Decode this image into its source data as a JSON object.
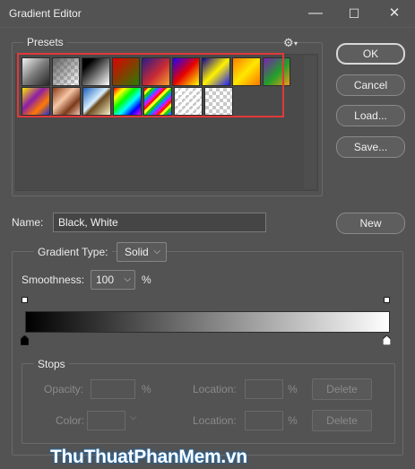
{
  "window": {
    "title": "Gradient Editor",
    "minimize_glyph": "—",
    "maximize_glyph": "☐",
    "close_glyph": "✕"
  },
  "presets": {
    "label": "Presets",
    "gear_glyph": "⚙",
    "gear_menu_glyph": "▾",
    "row1": [
      {
        "name": "foreground-to-background-swatch",
        "css": "linear-gradient(135deg,#f2f2f2,#7b7b7b 50%,#262626)",
        "checker": false
      },
      {
        "name": "foreground-to-transparent-swatch",
        "css": "linear-gradient(135deg,rgba(90,90,90,0.95),rgba(255,255,255,0))",
        "checker": true
      },
      {
        "name": "black-white-swatch",
        "css": "linear-gradient(135deg,#000 0%,#000 20%,#fff 100%)",
        "checker": false
      },
      {
        "name": "red-green-swatch",
        "css": "linear-gradient(135deg,#e00000,#2a7d00)",
        "checker": false
      },
      {
        "name": "violet-orange-swatch",
        "css": "linear-gradient(135deg,#2a1b8a,#c92a35 55%,#f7a12d)",
        "checker": false
      },
      {
        "name": "blue-red-yellow-swatch",
        "css": "linear-gradient(135deg,#1f00ff,#e60000 50%,#ffff00)",
        "checker": false
      },
      {
        "name": "blue-yellow-blue-swatch",
        "css": "linear-gradient(135deg,#10009c,#fff200 50%,#1a1aff)",
        "checker": false
      },
      {
        "name": "orange-yellow-orange-swatch",
        "css": "linear-gradient(135deg,#ff7a00,#ffe800 50%,#ff7400)",
        "checker": false
      },
      {
        "name": "violet-green-orange-swatch",
        "css": "linear-gradient(135deg,#7a1fb0,#23a02a 55%,#f29a16)",
        "checker": false
      }
    ],
    "row2": [
      {
        "name": "yellow-violet-orange-blue-swatch",
        "css": "linear-gradient(135deg,#ffe700,#8b1fa6 40%,#ff7a00 70%,#1d2fd6)",
        "checker": false
      },
      {
        "name": "copper-swatch",
        "css": "linear-gradient(135deg,#8c3b17,#f5c6a6 40%,#7b3a1a 70%,#f2c7ae)",
        "checker": false
      },
      {
        "name": "chrome-swatch",
        "css": "linear-gradient(135deg,#1a5fb8,#d8efff 45%,#6b4a1f 55%,#f8f2c8)",
        "checker": false
      },
      {
        "name": "spectrum-swatch",
        "css": "linear-gradient(135deg,#ff0000,#ffff00 20%,#00ff00 40%,#00ffff 60%,#0000ff 80%,#ff00ff)",
        "checker": false
      },
      {
        "name": "transparent-rainbow-swatch",
        "css": "repeating-linear-gradient(135deg,rgba(255,0,0,0.9) 0 3px,rgba(255,255,0,0.9) 3px 6px,rgba(0,200,0,0.9) 6px 9px,rgba(0,120,255,0.9) 9px 12px,rgba(200,0,255,0.9) 12px 15px)",
        "checker": true
      },
      {
        "name": "transparent-stripes-swatch",
        "css": "repeating-linear-gradient(135deg,rgba(255,255,255,0.95) 0 3px,rgba(0,0,0,0) 3px 6px)",
        "checker": true
      },
      {
        "name": "neutral-density-swatch",
        "css": "linear-gradient(135deg,rgba(0,0,0,0),rgba(0,0,0,0))",
        "checker": true
      }
    ]
  },
  "buttons": {
    "ok": "OK",
    "cancel": "Cancel",
    "load": "Load...",
    "save": "Save...",
    "new": "New"
  },
  "name_field": {
    "label": "Name:",
    "value": "Black, White"
  },
  "gradient_type": {
    "label": "Gradient Type:",
    "value": "Solid"
  },
  "smoothness": {
    "label": "Smoothness:",
    "value": "100",
    "unit": "%"
  },
  "gradient_bar": {
    "start_color": "#000000",
    "end_color": "#ffffff"
  },
  "stops": {
    "label": "Stops",
    "opacity_label": "Opacity:",
    "opacity_value": "",
    "opacity_unit": "%",
    "opacity_location_label": "Location:",
    "opacity_location_value": "",
    "opacity_location_unit": "%",
    "opacity_delete": "Delete",
    "color_label": "Color:",
    "color_location_label": "Location:",
    "color_location_value": "",
    "color_location_unit": "%",
    "color_delete": "Delete"
  },
  "watermark": {
    "text": "ThuThuatPhanMem.vn"
  }
}
